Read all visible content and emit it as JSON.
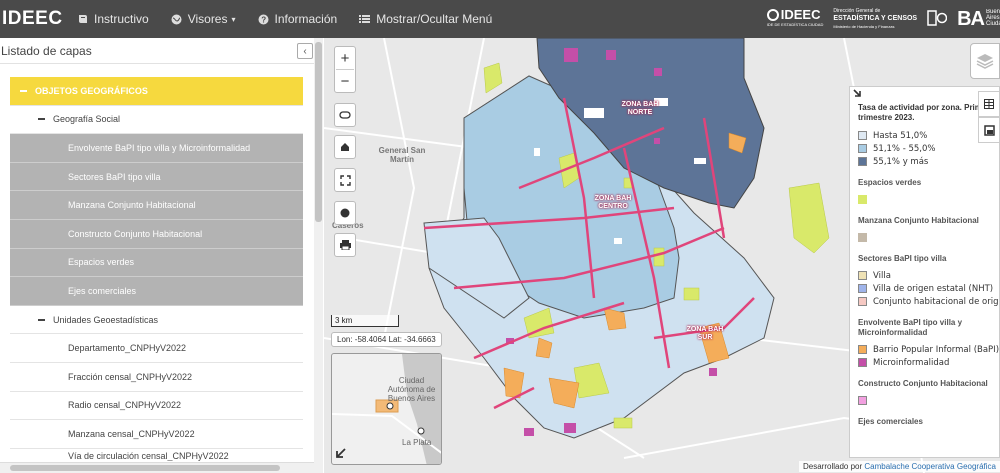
{
  "app": {
    "brand": "IDEEC",
    "nav": [
      {
        "label": "Instructivo",
        "icon": "book-icon"
      },
      {
        "label": "Visores",
        "icon": "globe-icon",
        "has_caret": true
      },
      {
        "label": "Información",
        "icon": "question-circle-icon"
      },
      {
        "label": "Mostrar/Ocultar Menú",
        "icon": "list-icon"
      }
    ],
    "logos": {
      "ideec": "IDEEC",
      "ideec_sub": "IDE DE ESTADÍSTICA CIUDAD",
      "dgeyc_top": "Dirección General de",
      "dgeyc_main": "ESTADÍSTICA Y CENSOS",
      "dgeyc_sub": "Ministerio de Hacienda y Finanzas",
      "ba": "BA",
      "ba_sub": "Buenos Aires Ciudad"
    }
  },
  "panel": {
    "title": "Listado de capas",
    "collapse_glyph": "‹",
    "tree": [
      {
        "type": "root",
        "label": "OBJETOS GEOGRÁFICOS"
      },
      {
        "type": "group",
        "label": "Geografía Social"
      },
      {
        "type": "layer",
        "label": "Envolvente BaPI tipo villa y Microinformalidad"
      },
      {
        "type": "layer",
        "label": "Sectores BaPI tipo villa"
      },
      {
        "type": "layer",
        "label": "Manzana Conjunto Habitacional"
      },
      {
        "type": "layer",
        "label": "Constructo Conjunto Habitacional"
      },
      {
        "type": "layer",
        "label": "Espacios verdes"
      },
      {
        "type": "layer",
        "label": "Ejes comerciales"
      },
      {
        "type": "group",
        "label": "Unidades Geoestadísticas"
      },
      {
        "type": "sublayer",
        "label": "Departamento_CNPHyV2022"
      },
      {
        "type": "sublayer",
        "label": "Fracción censal_CNPHyV2022"
      },
      {
        "type": "sublayer",
        "label": "Radio censal_CNPHyV2022"
      },
      {
        "type": "sublayer",
        "label": "Manzana censal_CNPHyV2022"
      },
      {
        "type": "sublayer",
        "label": "Vía de circulación censal_CNPHyV2022"
      }
    ]
  },
  "map": {
    "controls": {
      "zoom_in": "+",
      "zoom_out": "−"
    },
    "scale": "3 km",
    "coords": "Lon: -58.4064 Lat: -34.6663",
    "place_labels": {
      "general_san_martin": "General San Martín",
      "caseros": "Caseros"
    },
    "zones": [
      "ZONA BAH NORTE",
      "ZONA BAH CENTRO",
      "ZONA BAH SUR"
    ],
    "minimap": {
      "caba": "Ciudad Autónoma de Buenos Aires",
      "la_plata": "La Plata"
    },
    "attribution_prefix": "Desarrollado por ",
    "attribution_link": "Cambalache Cooperativa Geográfica"
  },
  "legend": {
    "title": "Tasa de actividad por zona. Primer trimestre 2023.",
    "activity": [
      {
        "label": "Hasta 51,0%",
        "color": "#dfe9f3"
      },
      {
        "label": "51,1% - 55,0%",
        "color": "#a9cce3"
      },
      {
        "label": "55,1% y más",
        "color": "#5d7497"
      }
    ],
    "espacios_verdes": {
      "title": "Espacios verdes",
      "color": "#d9e96a"
    },
    "manzana_conjunto": {
      "title": "Manzana Conjunto Habitacional",
      "color": "#c4b9a9"
    },
    "sectores": {
      "title": "Sectores BaPI tipo villa",
      "items": [
        {
          "label": "Villa",
          "color": "#efe2b5"
        },
        {
          "label": "Villa de origen estatal (NHT)",
          "color": "#9fb4ea"
        },
        {
          "label": "Conjunto habitacional de origen estatal",
          "color": "#f6c9c3"
        }
      ]
    },
    "envolvente": {
      "title": "Envolvente BaPI tipo villa y Microinformalidad",
      "items": [
        {
          "label": "Barrio Popular Informal (BaPI)",
          "color": "#f4ad5a"
        },
        {
          "label": "Microinformalidad",
          "color": "#c44fa8"
        }
      ]
    },
    "constructo": {
      "title": "Constructo Conjunto Habitacional",
      "color": "#f2a0e0"
    },
    "ejes": {
      "title": "Ejes comerciales"
    }
  }
}
